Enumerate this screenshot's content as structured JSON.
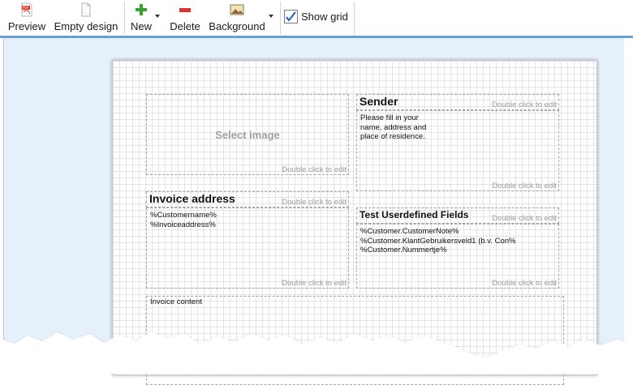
{
  "toolbar": {
    "preview_label": "Preview",
    "empty_design_label": "Empty design",
    "new_label": "New",
    "delete_label": "Delete",
    "background_label": "Background",
    "show_grid_label": "Show grid",
    "show_grid_checked": true
  },
  "canvas": {
    "select_image": "Select image",
    "double_click_hint": "Double click to edit",
    "sender": {
      "title": "Sender",
      "lines": [
        "Please fill in your",
        "name, address and",
        "place of residence."
      ]
    },
    "invoice_address": {
      "title": "Invoice address",
      "lines": [
        "%Customername%",
        "%Invoiceaddress%"
      ]
    },
    "userdefined": {
      "title": "Test Userdefined Fields",
      "lines": [
        "%Customer.CustomerNote%",
        "%Customer.KlantGebruikersveld1 (b.v. Con%",
        "%Customer.Nummertje%"
      ]
    },
    "invoice_content": "Invoice content"
  },
  "colors": {
    "workspace_bg": "#e6f0fb",
    "accent_line": "#6a9fcf",
    "grid_line": "#e3e3e3",
    "checkbox_check": "#1f5fbf"
  },
  "icons": [
    "pdf-preview-icon",
    "empty-page-icon",
    "plus-icon",
    "minus-icon",
    "image-icon",
    "checkbox-check-icon"
  ]
}
